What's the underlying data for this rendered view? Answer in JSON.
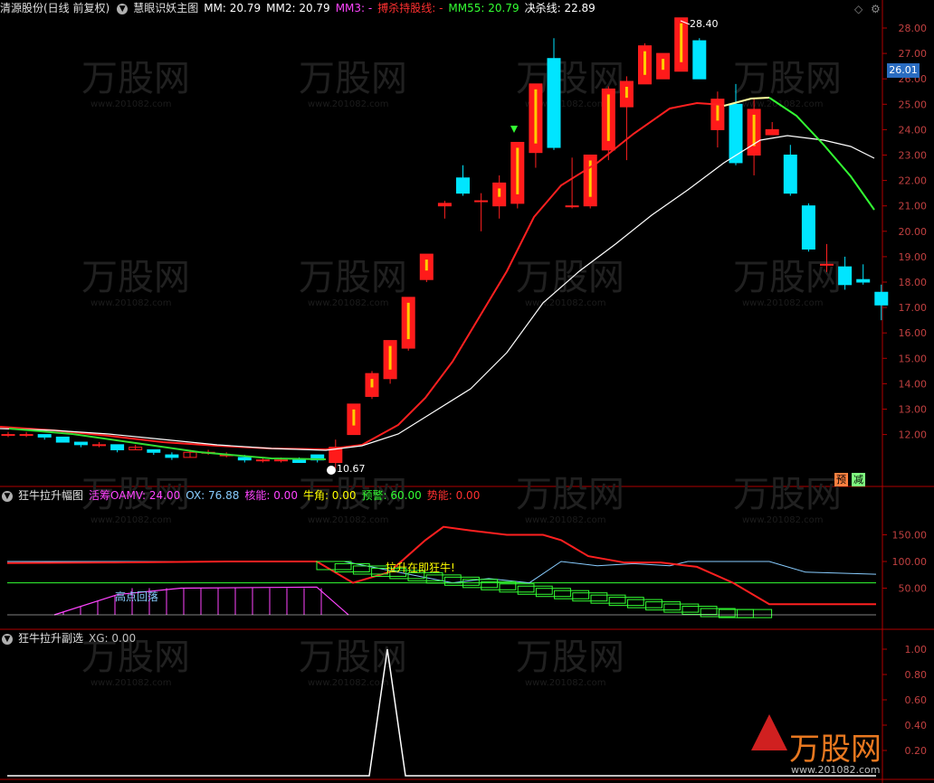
{
  "main_panel": {
    "title": "清源股份(日线 前复权)",
    "indicator_name": "慧眼识妖主图",
    "params": [
      {
        "label": "MM: 20.79",
        "color": "#ffffff"
      },
      {
        "label": "MM2: 20.79",
        "color": "#ffffff"
      },
      {
        "label": "MM3: -",
        "color": "#ff44ff"
      },
      {
        "label": "搏杀持股线: -",
        "color": "#ff3030"
      },
      {
        "label": "MM55: 20.79",
        "color": "#33ff33"
      },
      {
        "label": "决杀线: 22.89",
        "color": "#ffffff"
      }
    ],
    "current_price": "26.01",
    "high_label": "28.40",
    "low_label": "10.67",
    "badges": [
      {
        "text": "预",
        "color": "#ff8040"
      },
      {
        "text": "减",
        "color": "#80ff80"
      }
    ],
    "y_axis": [
      "28.00",
      "27.00",
      "26.00",
      "25.00",
      "24.00",
      "23.00",
      "22.00",
      "21.00",
      "20.00",
      "19.00",
      "18.00",
      "17.00",
      "16.00",
      "15.00",
      "14.00",
      "13.00",
      "12.00"
    ]
  },
  "sub_panel1": {
    "title": "狂牛拉升幅图",
    "params": [
      {
        "label": "活筹OAMV: 24.00",
        "color": "#ff44ff"
      },
      {
        "label": "OX: 76.88",
        "color": "#88ccff"
      },
      {
        "label": "核能: 0.00",
        "color": "#ff44ff"
      },
      {
        "label": "牛角: 0.00",
        "color": "#ffff00"
      },
      {
        "label": "预警: 60.00",
        "color": "#33ff33"
      },
      {
        "label": "势能: 0.00",
        "color": "#ff3030"
      }
    ],
    "annotations": {
      "high_drop": "高点回落",
      "rally": "拉升在即狂牛!"
    },
    "y_axis": [
      "150.00",
      "100.00",
      "50.00"
    ]
  },
  "sub_panel2": {
    "title": "狂牛拉升副选",
    "params": [
      {
        "label": "XG: 0.00",
        "color": "#c0c0c0"
      }
    ],
    "y_axis": [
      "1.00",
      "0.80",
      "0.60",
      "0.40",
      "0.20"
    ]
  },
  "watermark": {
    "brand": "万股网",
    "url": "www.201082.com"
  },
  "colors": {
    "up": "#ff2020",
    "down": "#00e5ff",
    "axis": "#b00000"
  },
  "chart_data": {
    "type": "candlestick",
    "candles": [
      [
        12.0,
        12.0,
        12.1,
        11.9
      ],
      [
        12.0,
        12.0,
        12.1,
        11.9
      ],
      [
        12.0,
        11.9,
        12.0,
        11.8
      ],
      [
        11.9,
        11.7,
        11.9,
        11.7
      ],
      [
        11.7,
        11.6,
        11.7,
        11.5
      ],
      [
        11.6,
        11.6,
        11.7,
        11.5
      ],
      [
        11.6,
        11.4,
        11.6,
        11.3
      ],
      [
        11.4,
        11.5,
        11.6,
        11.4
      ],
      [
        11.4,
        11.3,
        11.4,
        11.2
      ],
      [
        11.2,
        11.1,
        11.3,
        11.0
      ],
      [
        11.1,
        11.3,
        11.4,
        11.1
      ],
      [
        11.3,
        11.3,
        11.4,
        11.2
      ],
      [
        11.2,
        11.2,
        11.3,
        11.1
      ],
      [
        11.1,
        11.0,
        11.2,
        10.9
      ],
      [
        11.0,
        11.0,
        11.1,
        10.9
      ],
      [
        11.0,
        11.0,
        11.1,
        10.9
      ],
      [
        11.0,
        10.9,
        11.1,
        10.9
      ],
      [
        11.2,
        11.0,
        11.2,
        10.9
      ],
      [
        10.9,
        11.5,
        11.8,
        10.67
      ],
      [
        12.0,
        13.2,
        13.2,
        12.0
      ],
      [
        13.5,
        14.4,
        14.5,
        13.4
      ],
      [
        14.2,
        15.7,
        15.7,
        14.0
      ],
      [
        15.4,
        17.4,
        17.4,
        15.3
      ],
      [
        18.1,
        19.1,
        19.1,
        18.0
      ],
      [
        21.0,
        21.1,
        21.2,
        20.5
      ],
      [
        22.1,
        21.5,
        22.6,
        21.4
      ],
      [
        21.2,
        21.2,
        21.5,
        20.0
      ],
      [
        21.0,
        21.9,
        22.2,
        20.5
      ],
      [
        21.1,
        23.5,
        23.5,
        20.9
      ],
      [
        23.1,
        25.8,
        25.8,
        22.5
      ],
      [
        26.8,
        23.3,
        27.6,
        23.2
      ],
      [
        21.0,
        21.0,
        22.9,
        20.9
      ],
      [
        21.0,
        23.0,
        23.0,
        20.9
      ],
      [
        23.2,
        25.6,
        25.7,
        22.8
      ],
      [
        24.9,
        25.9,
        26.1,
        22.8
      ],
      [
        25.8,
        27.3,
        27.4,
        25.8
      ],
      [
        26.0,
        27.0,
        27.0,
        26.0
      ],
      [
        26.3,
        28.4,
        28.4,
        26.3
      ],
      [
        27.5,
        26.0,
        27.6,
        26.0
      ],
      [
        24.0,
        25.2,
        25.5,
        23.3
      ],
      [
        25.0,
        22.7,
        25.8,
        22.6
      ],
      [
        23.0,
        24.8,
        25.2,
        22.2
      ],
      [
        23.8,
        24.0,
        24.3,
        23.8
      ],
      [
        23.0,
        21.5,
        23.4,
        21.4
      ],
      [
        21.0,
        19.3,
        21.1,
        19.2
      ],
      [
        18.7,
        18.7,
        19.5,
        18.4
      ],
      [
        18.6,
        17.9,
        19.0,
        17.7
      ],
      [
        18.1,
        18.0,
        18.7,
        17.9
      ],
      [
        17.6,
        17.1,
        17.9,
        16.5
      ]
    ]
  }
}
